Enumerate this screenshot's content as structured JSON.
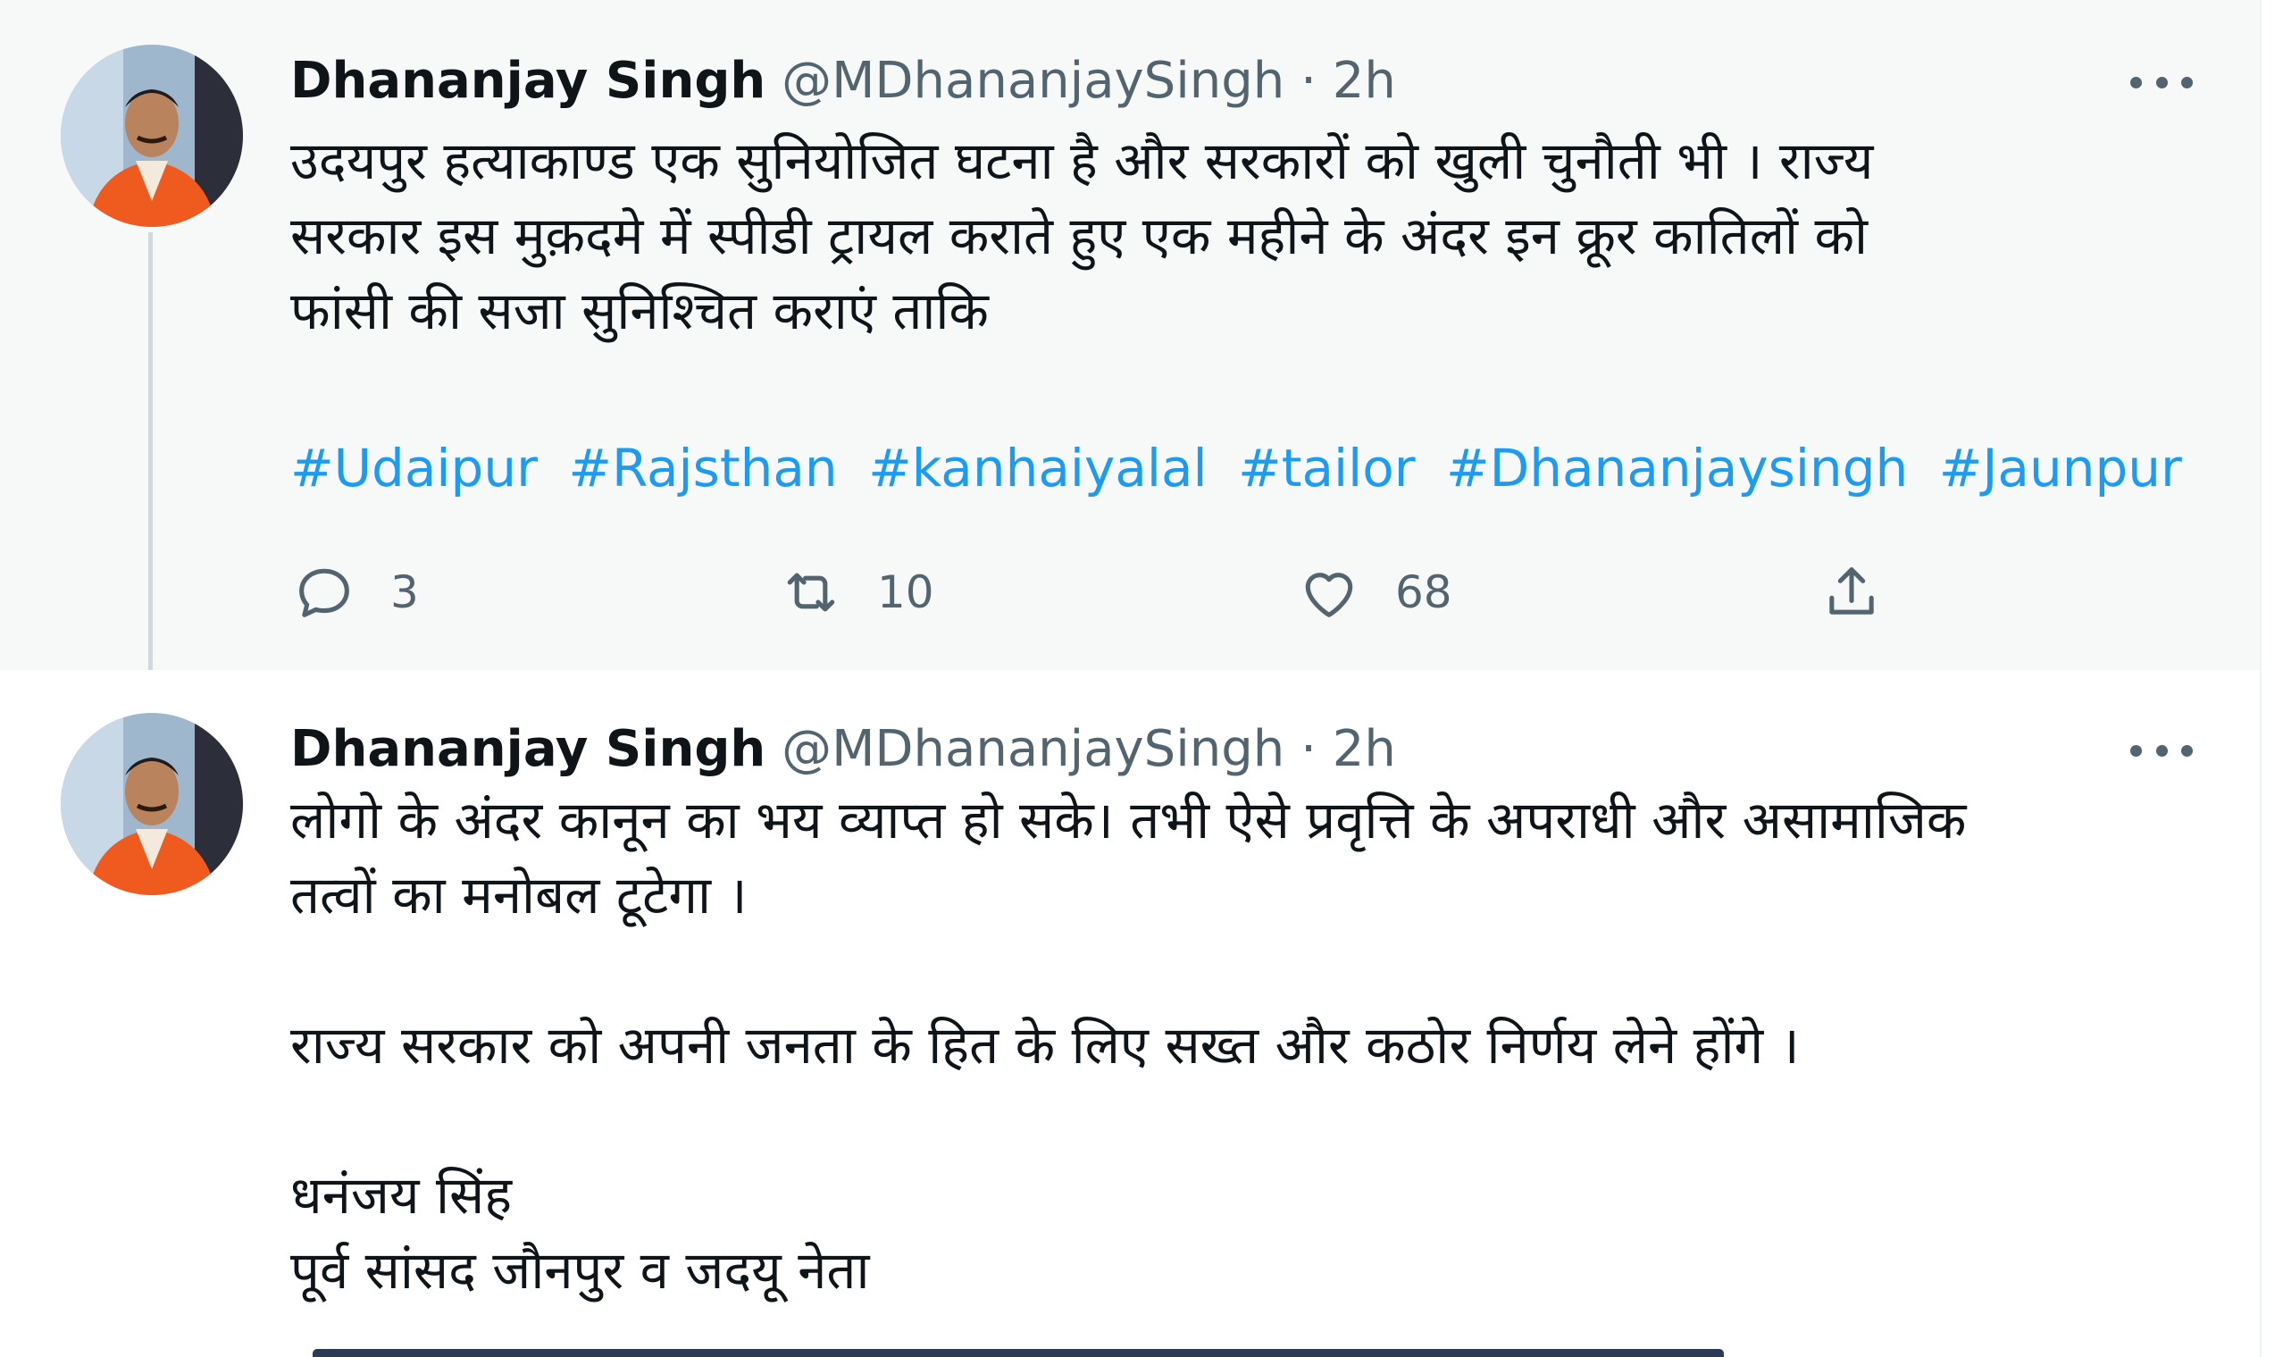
{
  "tweets": [
    {
      "author_name": "Dhananjay Singh",
      "handle": "@MDhananjaySingh",
      "separator": "·",
      "time": "2h",
      "body_lines": [
        "उदयपुर हत्याकाण्ड एक सुनियोजित घटना है और सरकारों को खुली चुनौती भी । राज्य",
        "सरकार इस मुक़दमे में स्पीडी ट्रायल कराते हुए एक महीने के अंदर इन क्रूर कातिलों को",
        "फांसी की सजा सुनिश्चित कराएं ताकि"
      ],
      "hashtags": [
        "#Udaipur",
        "#Rajsthan",
        "#kanhaiyalal",
        "#tailor",
        "#Dhananjaysingh",
        "#Jaunpur"
      ],
      "reply_count": "3",
      "retweet_count": "10",
      "like_count": "68"
    },
    {
      "author_name": "Dhananjay Singh",
      "handle": "@MDhananjaySingh",
      "separator": "·",
      "time": "2h",
      "paragraph1_lines": [
        "लोगो के अंदर कानून का भय व्याप्त हो सके। तभी ऐसे प्रवृत्ति के अपराधी और असामाजिक",
        "तत्वों का मनोबल टूटेगा ।"
      ],
      "paragraph2": "राज्य सरकार को अपनी जनता के हित के लिए सख्त और कठोर निर्णय लेने होंगे ।",
      "signature_lines": [
        "धनंजय सिंह",
        "पूर्व सांसद जौनपुर व जदयू नेता"
      ]
    }
  ],
  "colors": {
    "link": "#1d9bf0",
    "muted": "#536471",
    "text": "#0f1419",
    "highlight_bg": "#f7f9f9",
    "thread_line": "#cfd9de"
  },
  "icons": [
    "more-icon",
    "reply-icon",
    "retweet-icon",
    "like-icon",
    "share-icon"
  ]
}
